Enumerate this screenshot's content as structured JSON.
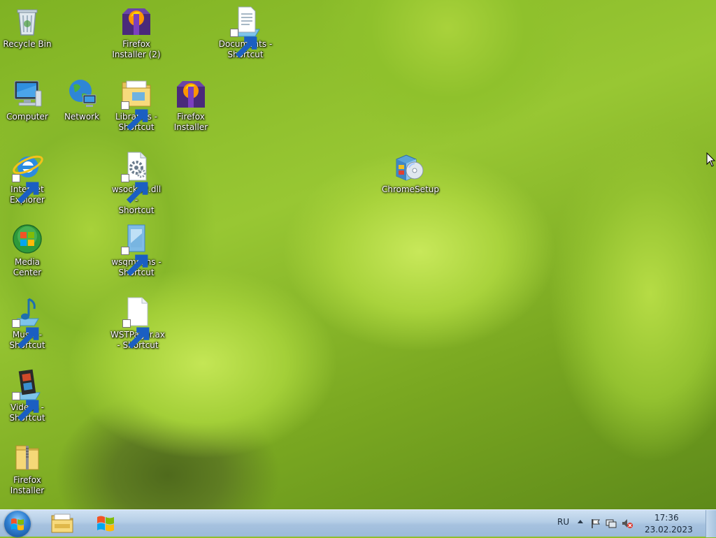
{
  "desktop": {
    "icons": {
      "recycle_bin": "Recycle Bin",
      "firefox_installer_2": "Firefox\nInstaller (2)",
      "documents_shortcut": "Documents -\nShortcut",
      "computer": "Computer",
      "network": "Network",
      "libraries_shortcut": "Libraries -\nShortcut",
      "firefox_installer": "Firefox\nInstaller",
      "internet_explorer": "Internet\nExplorer",
      "wsock32_shortcut": "wsock32.dll -\nShortcut",
      "chromesetup": "ChromeSetup",
      "media_center": "Media Center",
      "wsqmcons_shortcut": "wsqmcons -\nShortcut",
      "music_shortcut": "Music -\nShortcut",
      "wstpager_shortcut": "WSTPager.ax\n- Shortcut",
      "videos_shortcut": "Videos -\nShortcut",
      "firefox_installer_zip": "Firefox\nInstaller"
    }
  },
  "taskbar": {
    "language": "RU",
    "time": "17:36",
    "date": "23.02.2023"
  },
  "icons_semantic": {
    "start": "windows-start-icon",
    "explorer": "folder-explorer-icon",
    "windows": "windows-logo-icon",
    "tray_up": "chevron-up-icon",
    "action_center": "flag-icon",
    "network": "network-icon",
    "volume": "speaker-muted-icon"
  },
  "colors": {
    "taskbar": "#b4cde6",
    "wallpaper": "#98c733"
  }
}
